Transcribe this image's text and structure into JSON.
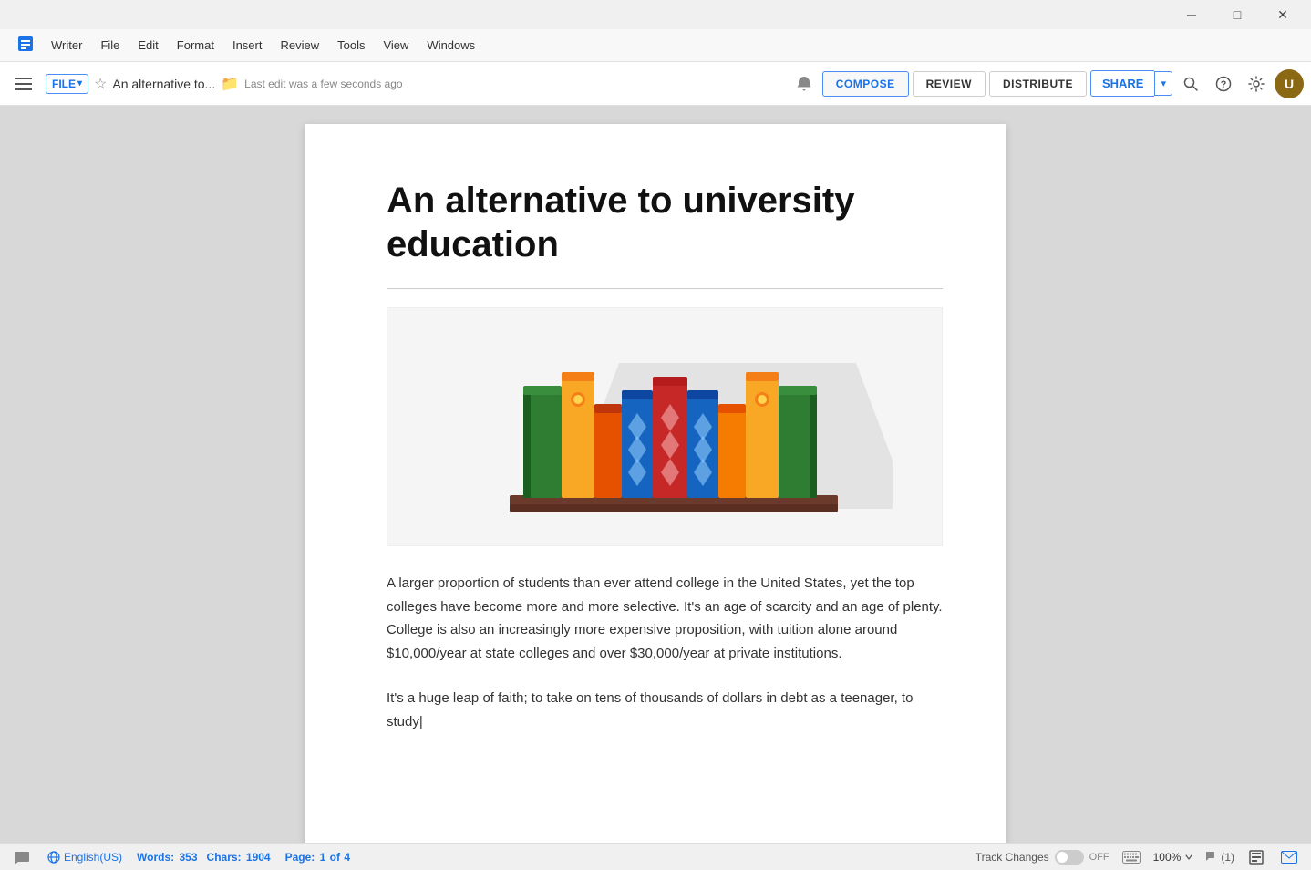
{
  "app": {
    "name": "Writer"
  },
  "titlebar": {
    "minimize": "─",
    "maximize": "□",
    "close": "✕"
  },
  "menubar": {
    "items": [
      "Writer",
      "File",
      "Edit",
      "Format",
      "Insert",
      "Review",
      "Tools",
      "View",
      "Windows"
    ]
  },
  "toolbar": {
    "hamburger_label": "menu",
    "file_btn": "FILE",
    "file_dropdown": "▾",
    "doc_title": "An alternative to...",
    "last_edit": "Last edit was a few seconds ago",
    "compose_label": "COMPOSE",
    "review_label": "REVIEW",
    "distribute_label": "DISTRIBUTE",
    "share_label": "SHARE",
    "share_dropdown": "▾"
  },
  "document": {
    "heading": "An alternative to university education",
    "paragraph1": "A larger proportion of students than ever attend college in the United States, yet the top colleges have become more and more selective. It's an age of scarcity and an age of plenty. College is also an increasingly more expensive proposition, with tuition alone around $10,000/year at state colleges and over $30,000/year at private institutions.",
    "paragraph2": "It's a huge leap of faith; to take on tens of thousands of dollars in debt as a teenager, to study"
  },
  "statusbar": {
    "comment_icon": "💬",
    "lang_flag": "🌐",
    "lang": "English(US)",
    "words_label": "Words:",
    "words_count": "353",
    "chars_label": "Chars:",
    "chars_count": "1904",
    "page_label": "Page:",
    "page_current": "1",
    "page_total": "4",
    "track_changes_label": "Track Changes",
    "track_state": "OFF",
    "zoom_value": "100%",
    "comments_count": "(1)",
    "keyboard_icon": "⌨"
  }
}
